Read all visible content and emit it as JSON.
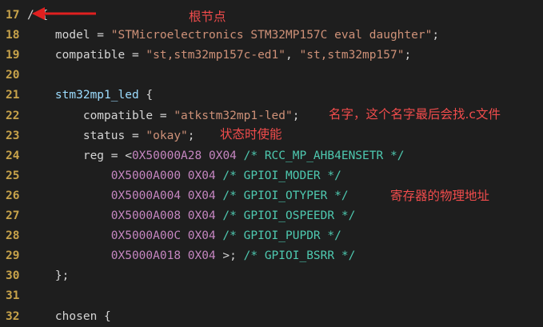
{
  "lines": [
    {
      "num": "17",
      "tokens": [
        {
          "t": "/ {",
          "c": "plain"
        }
      ]
    },
    {
      "num": "18",
      "tokens": [
        {
          "t": "    model = ",
          "c": "plain"
        },
        {
          "t": "\"STMicroelectronics STM32MP157C eval daughter\"",
          "c": "str"
        },
        {
          "t": ";",
          "c": "plain"
        }
      ]
    },
    {
      "num": "19",
      "tokens": [
        {
          "t": "    compatible = ",
          "c": "plain"
        },
        {
          "t": "\"st,stm32mp157c-ed1\"",
          "c": "str"
        },
        {
          "t": ", ",
          "c": "plain"
        },
        {
          "t": "\"st,stm32mp157\"",
          "c": "str"
        },
        {
          "t": ";",
          "c": "plain"
        }
      ]
    },
    {
      "num": "20",
      "tokens": []
    },
    {
      "num": "21",
      "tokens": [
        {
          "t": "    stm32mp1_led",
          "c": "ident"
        },
        {
          "t": " {",
          "c": "plain"
        }
      ]
    },
    {
      "num": "22",
      "tokens": [
        {
          "t": "        compatible = ",
          "c": "plain"
        },
        {
          "t": "\"atkstm32mp1-led\"",
          "c": "str"
        },
        {
          "t": ";",
          "c": "plain"
        }
      ]
    },
    {
      "num": "23",
      "tokens": [
        {
          "t": "        status = ",
          "c": "plain"
        },
        {
          "t": "\"okay\"",
          "c": "str"
        },
        {
          "t": ";",
          "c": "plain"
        }
      ]
    },
    {
      "num": "24",
      "tokens": [
        {
          "t": "        reg = <",
          "c": "plain"
        },
        {
          "t": "0X50000A28 0X04",
          "c": "hex"
        },
        {
          "t": " /* RCC_MP_AHB4ENSETR */",
          "c": "comment"
        }
      ]
    },
    {
      "num": "25",
      "tokens": [
        {
          "t": "            0X5000A000 0X04",
          "c": "hex"
        },
        {
          "t": " /* GPIOI_MODER */",
          "c": "comment"
        }
      ]
    },
    {
      "num": "26",
      "tokens": [
        {
          "t": "            0X5000A004 0X04",
          "c": "hex"
        },
        {
          "t": " /* GPIOI_OTYPER */",
          "c": "comment"
        }
      ]
    },
    {
      "num": "27",
      "tokens": [
        {
          "t": "            0X5000A008 0X04",
          "c": "hex"
        },
        {
          "t": " /* GPIOI_OSPEEDR */",
          "c": "comment"
        }
      ]
    },
    {
      "num": "28",
      "tokens": [
        {
          "t": "            0X5000A00C 0X04",
          "c": "hex"
        },
        {
          "t": " /* GPIOI_PUPDR */",
          "c": "comment"
        }
      ]
    },
    {
      "num": "29",
      "tokens": [
        {
          "t": "            0X5000A018 0X04",
          "c": "hex"
        },
        {
          "t": " >;",
          "c": "plain"
        },
        {
          "t": " /* GPIOI_BSRR */",
          "c": "comment"
        }
      ]
    },
    {
      "num": "30",
      "tokens": [
        {
          "t": "    };",
          "c": "plain"
        }
      ]
    },
    {
      "num": "31",
      "tokens": []
    },
    {
      "num": "32",
      "tokens": [
        {
          "t": "    chosen {",
          "c": "plain"
        }
      ]
    }
  ],
  "annotations": {
    "root_node": "根节点",
    "name_note": "名字，这个名字最后会找.c文件",
    "status_note": "状态时使能",
    "reg_note": "寄存器的物理地址"
  },
  "colors": {
    "background": "#1e1e1e",
    "line_number": "#c8a34a",
    "string": "#ce9178",
    "hex": "#c586c0",
    "comment": "#4ec9b0",
    "annotation": "#f14c4c"
  }
}
